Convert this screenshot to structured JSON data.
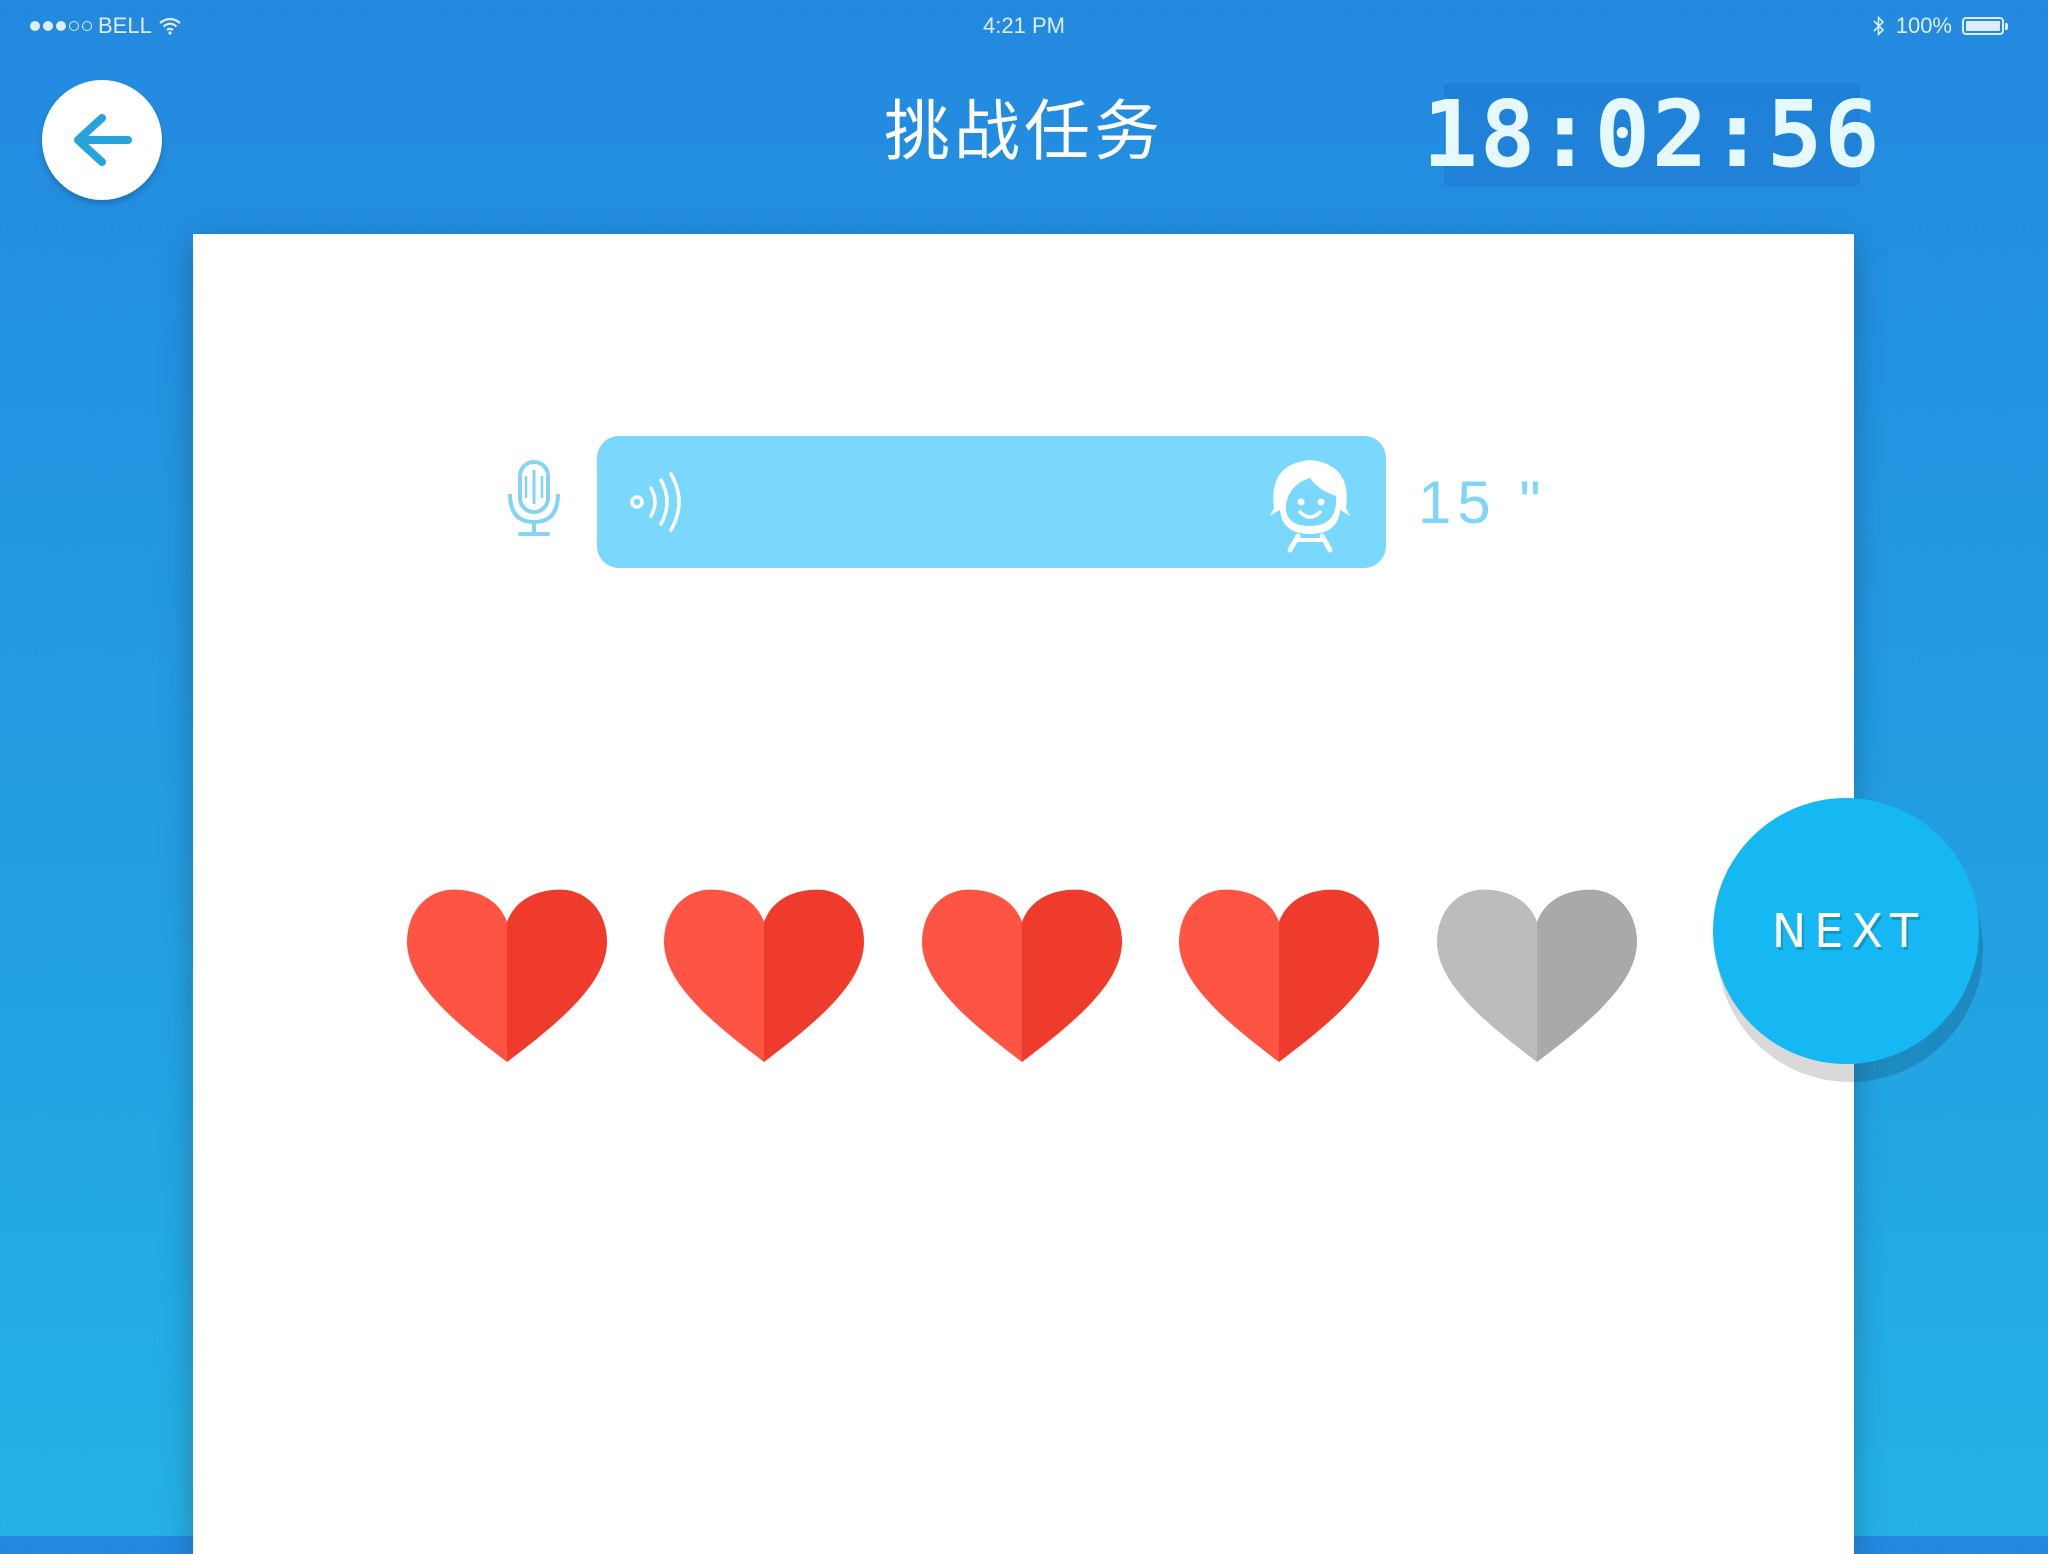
{
  "status_bar": {
    "carrier": "BELL",
    "time": "4:21 PM",
    "battery_percent": "100%"
  },
  "header": {
    "title": "挑战任务",
    "timer": "18:02:56"
  },
  "voice": {
    "duration": "15 \""
  },
  "hearts": {
    "total": 5,
    "filled": 4,
    "filled_colors": [
      "#fd5443",
      "#ef3b2c"
    ],
    "empty_colors": [
      "#bcbcbc",
      "#a9a9a9"
    ]
  },
  "next_button": {
    "label": "NEXT"
  },
  "colors": {
    "accent": "#15b8f2",
    "voice_bar": "#79d8fc",
    "heart_red": "#fd5443",
    "heart_gray": "#bcbcbc"
  },
  "icons": [
    "back-arrow-icon",
    "microphone-icon",
    "sound-wave-icon",
    "child-avatar-icon",
    "wifi-icon",
    "bluetooth-icon",
    "battery-icon"
  ]
}
